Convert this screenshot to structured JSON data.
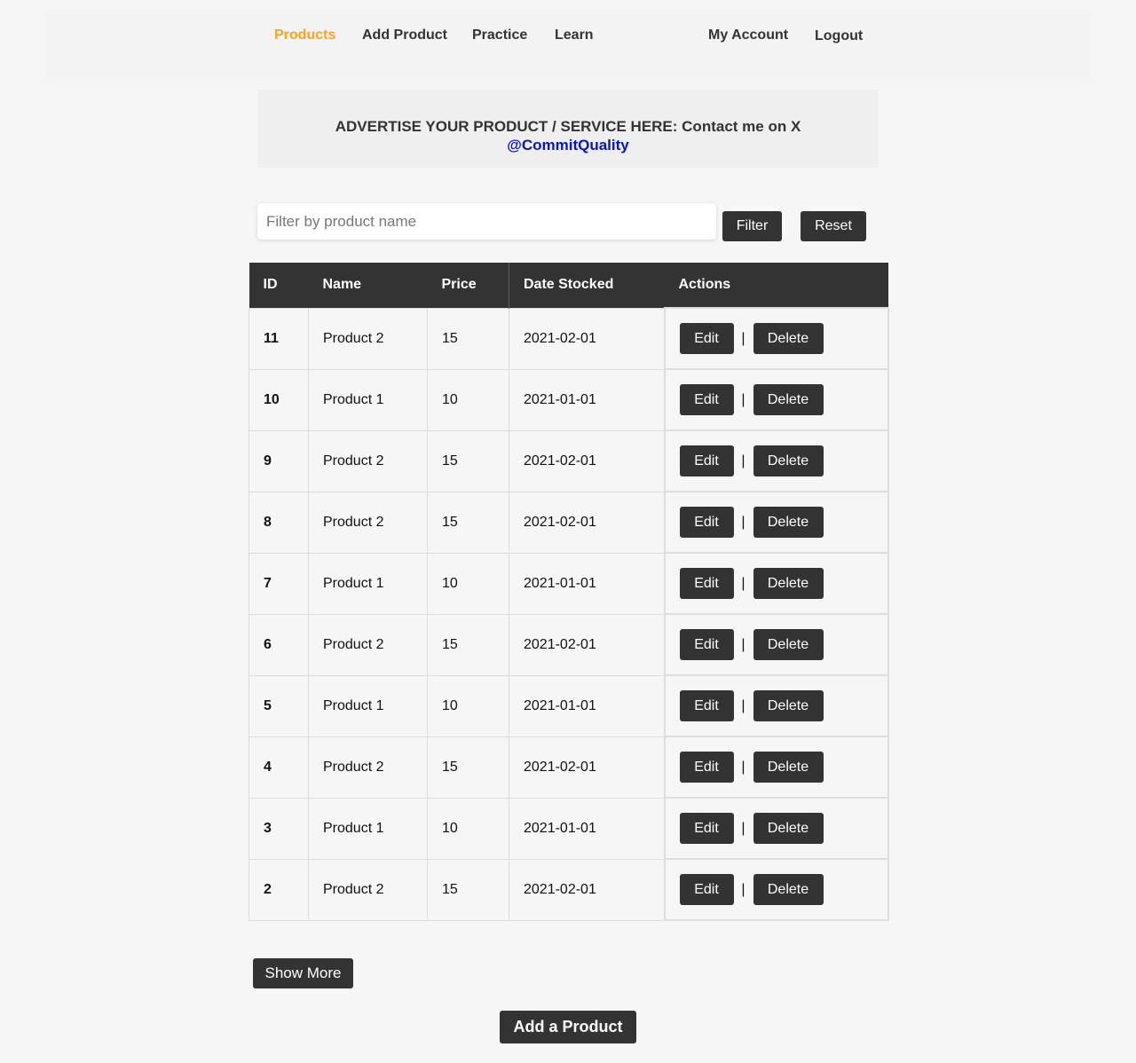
{
  "nav": {
    "products": "Products",
    "add_product": "Add Product",
    "practice": "Practice",
    "learn": "Learn",
    "my_account": "My Account",
    "logout": "Logout",
    "active_color": "#f5a623"
  },
  "ad": {
    "text": "ADVERTISE YOUR PRODUCT / SERVICE HERE: Contact me on X",
    "handle": "@CommitQuality"
  },
  "filter": {
    "placeholder": "Filter by product name",
    "value": "",
    "filter_label": "Filter",
    "reset_label": "Reset"
  },
  "table": {
    "headers": [
      "ID",
      "Name",
      "Price",
      "Date Stocked",
      "Actions"
    ],
    "rows": [
      {
        "id": "11",
        "name": "Product 2",
        "price": "15",
        "date": "2021-02-01"
      },
      {
        "id": "10",
        "name": "Product 1",
        "price": "10",
        "date": "2021-01-01"
      },
      {
        "id": "9",
        "name": "Product 2",
        "price": "15",
        "date": "2021-02-01"
      },
      {
        "id": "8",
        "name": "Product 2",
        "price": "15",
        "date": "2021-02-01"
      },
      {
        "id": "7",
        "name": "Product 1",
        "price": "10",
        "date": "2021-01-01"
      },
      {
        "id": "6",
        "name": "Product 2",
        "price": "15",
        "date": "2021-02-01"
      },
      {
        "id": "5",
        "name": "Product 1",
        "price": "10",
        "date": "2021-01-01"
      },
      {
        "id": "4",
        "name": "Product 2",
        "price": "15",
        "date": "2021-02-01"
      },
      {
        "id": "3",
        "name": "Product 1",
        "price": "10",
        "date": "2021-01-01"
      },
      {
        "id": "2",
        "name": "Product 2",
        "price": "15",
        "date": "2021-02-01"
      }
    ],
    "edit_label": "Edit",
    "delete_label": "Delete",
    "separator": "|"
  },
  "show_more_label": "Show More",
  "add_product_label": "Add a Product"
}
